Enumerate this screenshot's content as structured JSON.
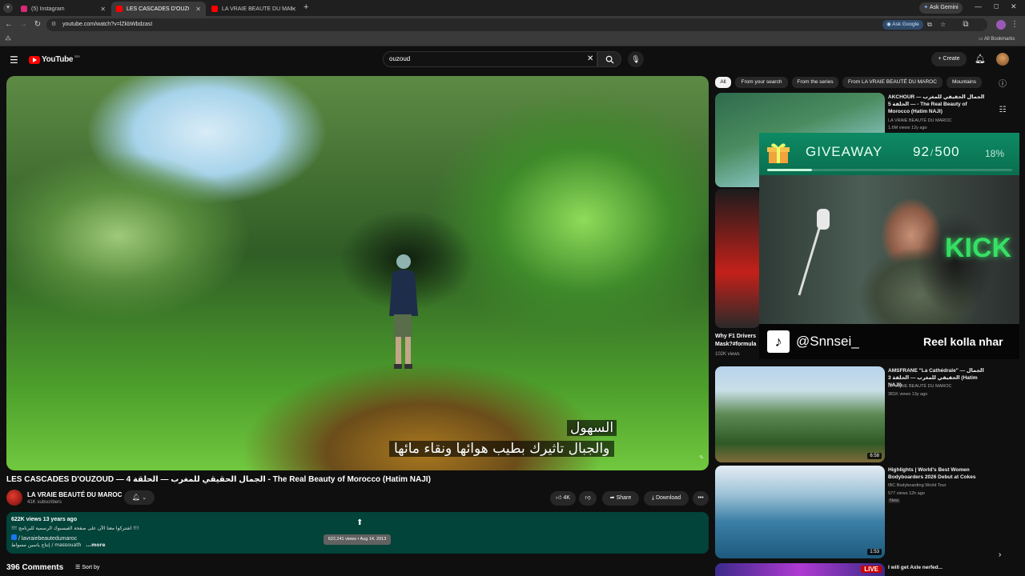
{
  "browser": {
    "tabs": [
      {
        "label": "(5) Instagram",
        "color": "#d62976"
      },
      {
        "label": "LES CASCADES D'OUZOUD",
        "color": "#ff0000"
      },
      {
        "label": "LA VRAIE BEAUTÉ DU MAROC",
        "color": "#ff0000"
      }
    ],
    "new_tab": "+",
    "ask_gemini": "Ask Gemini",
    "url": "youtube.com/watch?v=lZkbWbdzasI",
    "ask_google": "Ask Google",
    "all_bookmarks": "All Bookmarks"
  },
  "youtube": {
    "logo_text": "YouTube",
    "logo_badge": "MA",
    "search_value": "ouzoud",
    "create_label": "Create"
  },
  "video": {
    "subtitle_line1": "السهول",
    "subtitle_line2": "والجبال تاثيرك بطيب هوائها ونقاء مائها",
    "title": "LES CASCADES D'OUZOUD — الجمال الحقيقي للمغرب — الحلقة 4 - The Real Beauty of Morocco (Hatim NAJI)",
    "channel_name": "LA VRAIE BEAUTÉ DU MAROC",
    "subscribers": "41K subscribers",
    "likes": "4K",
    "share_label": "Share",
    "download_label": "Download",
    "more_label": "•••"
  },
  "description": {
    "meta": "622K views  13 years ago",
    "line2": "!!! اشتركوا معنا الآن على صفحة الفيسبوك الرسمية للبرنامج !!!",
    "line3": "/ lavraiebeautedumaroc",
    "line4": "إنتاج ياسين مسواط  / massouath",
    "more": "...more",
    "tooltip": "622,241 views • Aug 14, 2013"
  },
  "comments": {
    "count_label": "396 Comments",
    "sort_label": "Sort by"
  },
  "chips": [
    "All",
    "From your search",
    "From the series",
    "From LA VRAIE BEAUTÉ DU MAROC",
    "Mountains"
  ],
  "related": [
    {
      "title": "AKCHOUR — الجمال الحقيقي للمغرب — الحلقة 5 - The Real Beauty of Morocco (Hatim NAJI)",
      "channel": "LA VRAIE BEAUTÉ DU MAROC",
      "meta": "1.6M views  12y ago",
      "duration": ""
    },
    {
      "title": "Why F1 Drivers Mask?#formula",
      "channel": "",
      "meta": "102K views",
      "duration": ""
    },
    {
      "title": "AMSFRANE \"La Cathédrale\" — الجمال الحقيقي للمغرب — الحلقة 3 (Hatim NAJI)",
      "channel": "LA VRAIE BEAUTÉ DU MAROC",
      "meta": "381K views  13y ago",
      "duration": "6:58"
    },
    {
      "title": "Highlights | World's Best Women Bodyboarders 2026 Debut at Cokes",
      "channel": "IBC Bodyboarding World Tour",
      "meta": "577 views  12h ago",
      "badge": "New",
      "duration": "1:53"
    },
    {
      "title": "I will get Axle nerfed...",
      "channel": "",
      "meta": "",
      "duration": "",
      "live": "LIVE"
    }
  ],
  "overlay": {
    "giveaway_label": "GIVEAWAY",
    "count": "92",
    "separator": "/",
    "total": "500",
    "percent_label": "18%",
    "progress": 0.184,
    "tiktok_handle": "@Snnsei_",
    "tiktok_text": "Reel kolla nhar",
    "kick_text": "KICK"
  },
  "colors": {
    "yt_red": "#ff0000",
    "desc_bg": "#02433a",
    "giveaway_green": "#0d8a63"
  }
}
